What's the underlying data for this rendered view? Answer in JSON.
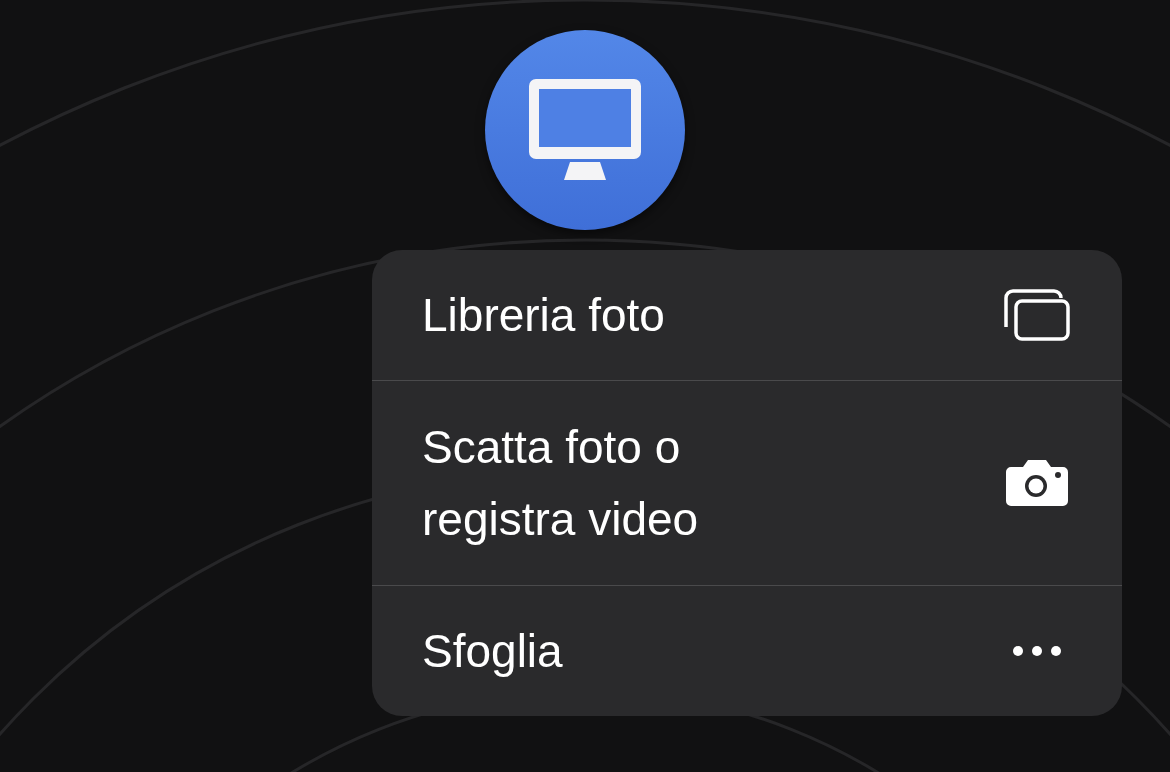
{
  "menu": {
    "items": [
      {
        "label": "Libreria foto",
        "kind": "photos"
      },
      {
        "label": "Scatta foto o registra video",
        "kind": "camera"
      },
      {
        "label": "Sfoglia",
        "kind": "more"
      }
    ]
  }
}
